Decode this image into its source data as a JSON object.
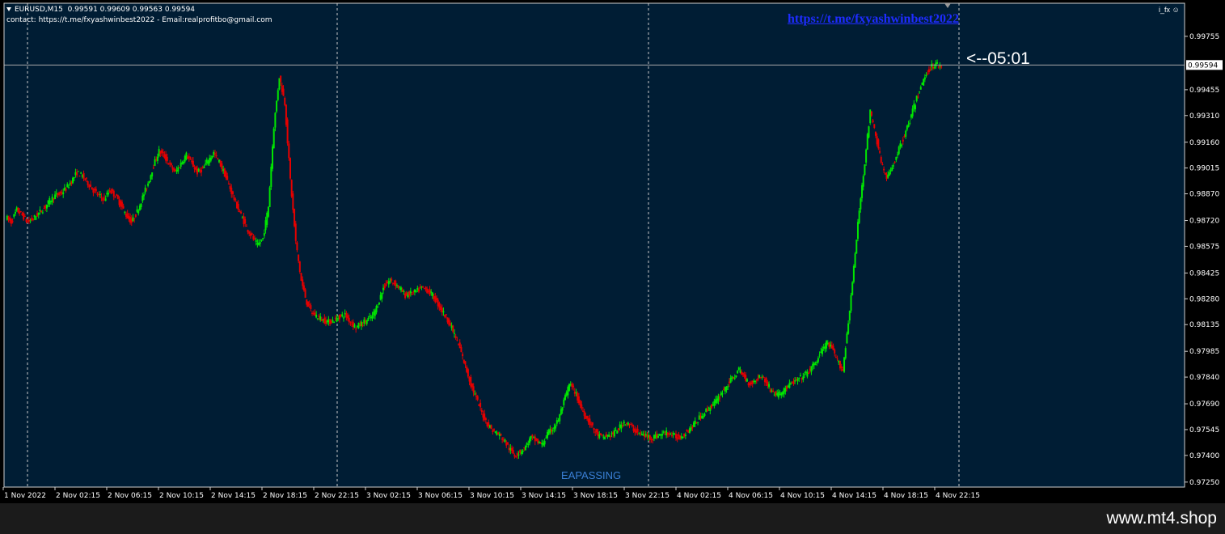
{
  "header": {
    "symbol": "EURUSD,M15",
    "ohlc": "0.99591 0.99609 0.99563 0.99594",
    "contact": "contact:   https://t.me/fxyashwinbest2022 - Email:realprofitbo@gmail.com"
  },
  "overlay": {
    "channel_link": "https://t.me/fxyashwinbest2022",
    "countdown": "<--05:01",
    "watermark": "EAPASSING",
    "indicator_tag": "i_fx"
  },
  "footer": {
    "site": "www.mt4.shop"
  },
  "colors": {
    "background": "#001d34",
    "bull": "#00e600",
    "bear": "#e60000",
    "grid": "#c8c8c8",
    "axis_text": "#ffffff",
    "current_price_line": "#a8a8a8"
  },
  "chart_data": {
    "type": "candlestick",
    "symbol": "EURUSD",
    "timeframe": "M15",
    "current_price": 0.99594,
    "ylim": [
      0.97222,
      0.99941
    ],
    "y_ticks": [
      0.99755,
      0.99455,
      0.9931,
      0.9916,
      0.99015,
      0.9887,
      0.9872,
      0.98575,
      0.98425,
      0.9828,
      0.98135,
      0.97985,
      0.9784,
      0.9769,
      0.97545,
      0.974,
      0.9725
    ],
    "x_ticks": [
      "1 Nov 2022",
      "2 Nov 02:15",
      "2 Nov 06:15",
      "2 Nov 10:15",
      "2 Nov 14:15",
      "2 Nov 18:15",
      "2 Nov 22:15",
      "3 Nov 02:15",
      "3 Nov 06:15",
      "3 Nov 10:15",
      "3 Nov 14:15",
      "3 Nov 18:15",
      "3 Nov 22:15",
      "4 Nov 02:15",
      "4 Nov 06:15",
      "4 Nov 10:15",
      "4 Nov 14:15",
      "4 Nov 18:15",
      "4 Nov 22:15"
    ],
    "day_separators": [
      "2 Nov",
      "3 Nov",
      "4 Nov",
      "5 Nov"
    ],
    "close_path": [
      0.9874,
      0.9871,
      0.9878,
      0.9875,
      0.9871,
      0.9873,
      0.9876,
      0.9879,
      0.9883,
      0.9886,
      0.9887,
      0.989,
      0.9894,
      0.9899,
      0.9897,
      0.9893,
      0.9889,
      0.9886,
      0.9884,
      0.9889,
      0.9886,
      0.9881,
      0.9875,
      0.9871,
      0.9877,
      0.9885,
      0.9893,
      0.9903,
      0.9911,
      0.9908,
      0.9903,
      0.9899,
      0.9904,
      0.9909,
      0.9904,
      0.9899,
      0.9901,
      0.9906,
      0.991,
      0.9905,
      0.9898,
      0.989,
      0.9882,
      0.9875,
      0.9868,
      0.9863,
      0.9858,
      0.9862,
      0.988,
      0.9925,
      0.9953,
      0.9938,
      0.9895,
      0.986,
      0.9838,
      0.9826,
      0.982,
      0.9818,
      0.9816,
      0.9815,
      0.9816,
      0.9818,
      0.9819,
      0.9815,
      0.9812,
      0.9814,
      0.9816,
      0.9818,
      0.9825,
      0.9834,
      0.9838,
      0.9837,
      0.9834,
      0.983,
      0.9831,
      0.9832,
      0.9834,
      0.9833,
      0.983,
      0.9825,
      0.982,
      0.9815,
      0.9808,
      0.98,
      0.979,
      0.978,
      0.9772,
      0.9764,
      0.9758,
      0.9754,
      0.9752,
      0.9749,
      0.9744,
      0.974,
      0.9742,
      0.9745,
      0.975,
      0.9748,
      0.9746,
      0.9752,
      0.9755,
      0.976,
      0.977,
      0.978,
      0.9776,
      0.9768,
      0.9762,
      0.9757,
      0.9752,
      0.975,
      0.9751,
      0.9752,
      0.9755,
      0.9759,
      0.9757,
      0.9754,
      0.9752,
      0.9751,
      0.975,
      0.9751,
      0.9752,
      0.9753,
      0.9751,
      0.975,
      0.9752,
      0.9755,
      0.9758,
      0.9762,
      0.9765,
      0.9768,
      0.9771,
      0.9776,
      0.978,
      0.9784,
      0.9788,
      0.9784,
      0.978,
      0.9782,
      0.9785,
      0.9781,
      0.9776,
      0.9774,
      0.9776,
      0.9779,
      0.9781,
      0.9783,
      0.9785,
      0.9788,
      0.9792,
      0.9798,
      0.9803,
      0.98,
      0.9793,
      0.9788,
      0.9815,
      0.9845,
      0.9878,
      0.9905,
      0.9933,
      0.992,
      0.9905,
      0.9895,
      0.9902,
      0.991,
      0.9918,
      0.9926,
      0.9936,
      0.9945,
      0.9953,
      0.9958,
      0.996,
      0.9959
    ]
  }
}
